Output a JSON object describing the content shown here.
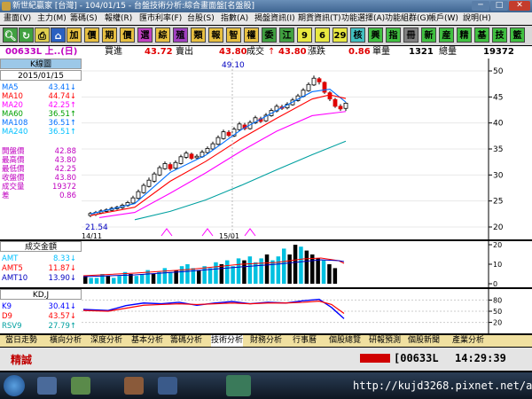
{
  "window": {
    "title": "新世紀贏家 [台灣] - 104/01/15 - 台盤技術分析:綜合畫面盤[名盤股]",
    "min": "─",
    "max": "□",
    "close": "✕"
  },
  "menu": [
    "畫面(V)",
    "主力(M)",
    "籌碼(S)",
    "報權(R)",
    "匯市利率(F)",
    "台股(S)",
    "指數(A)",
    "揭盤資訊(I)",
    "期貨資訊(T)",
    "功能選擇(A)",
    "功能組群(G)",
    "帳戶(W)",
    "說明(H)"
  ],
  "toolbar": {
    "buttons": [
      "加",
      "價",
      "期",
      "價",
      "選",
      "綜",
      "殖",
      "類",
      "報",
      "智",
      "權",
      "委",
      "江",
      "9",
      "6",
      "29",
      "核",
      "興",
      "指",
      "冊",
      "新",
      "産",
      "精",
      "基",
      "技",
      "籃"
    ]
  },
  "quote": {
    "symbol": "00633L 上..(日)",
    "buy_label": "買進",
    "buy": "43.72",
    "sell_label": "賣出",
    "sell": "43.80",
    "trade_label": "成交",
    "trade_arrow": "↑",
    "trade": "43.80",
    "change_label": "漲跌",
    "change": "0.86",
    "vol_label": "單量",
    "vol": "1321",
    "total_label": "總量",
    "total": "19372"
  },
  "kpanel": {
    "title": "K線圖",
    "date": "2015/01/15",
    "ma": [
      {
        "label": "MA5",
        "value": "43.41",
        "arrow": "↓",
        "color": "#0070ff"
      },
      {
        "label": "MA10",
        "value": "44.74",
        "arrow": "↓",
        "color": "#ff0000"
      },
      {
        "label": "MA20",
        "value": "42.25",
        "arrow": "↑",
        "color": "#ff00ff"
      },
      {
        "label": "MA60",
        "value": "36.51",
        "arrow": "↑",
        "color": "#00a000"
      },
      {
        "label": "MA108",
        "value": "36.51",
        "arrow": "↑",
        "color": "#0070ff"
      },
      {
        "label": "MA240",
        "value": "36.51",
        "arrow": "↑",
        "color": "#00c0ff"
      }
    ],
    "ohlc": [
      {
        "label": "開盤價",
        "value": "42.88"
      },
      {
        "label": "最高價",
        "value": "43.80"
      },
      {
        "label": "最低價",
        "value": "42.25"
      },
      {
        "label": "收盤價",
        "value": "43.80"
      },
      {
        "label": "成交量",
        "value": "19372"
      },
      {
        "label": "差",
        "value": "0.86"
      }
    ]
  },
  "kchart": {
    "high_label": "49.10",
    "low_label": "21.54",
    "x_labels": [
      "14/11",
      "15/01"
    ],
    "y_ticks": [
      "50",
      "45",
      "40",
      "35",
      "30",
      "25",
      "20"
    ]
  },
  "volpanel": {
    "title": "成交金額",
    "rows": [
      {
        "label": "AMT",
        "value": "8.33",
        "arrow": "↓",
        "color": "#00c0ff"
      },
      {
        "label": "AMT5",
        "value": "11.87",
        "arrow": "↓",
        "color": "#ff0000"
      },
      {
        "label": "AMT10",
        "value": "13.90",
        "arrow": "↓",
        "color": "#0000c0"
      }
    ],
    "y_ticks": [
      "20",
      "10",
      "0"
    ]
  },
  "kdpanel": {
    "title": "KD,J",
    "rows": [
      {
        "label": "K9",
        "value": "30.41",
        "arrow": "↓",
        "color": "#0000ff"
      },
      {
        "label": "D9",
        "value": "43.57",
        "arrow": "↓",
        "color": "#ff0000"
      },
      {
        "label": "RSV9",
        "value": "27.79",
        "arrow": "↑",
        "color": "#00a0a0"
      }
    ],
    "y_ticks": [
      "80",
      "50",
      "20"
    ]
  },
  "tabs": [
    "當日走勢",
    "橫向分析",
    "深度分析",
    "基本分析",
    "籌碼分析",
    "技術分析",
    "財務分析",
    "行事曆",
    "個股總覽",
    "研報預測",
    "個股新聞",
    "產業分析"
  ],
  "status": {
    "brand": "精誠",
    "code": "[00633L",
    "time": "14:29:39"
  },
  "taskbar": {
    "url": "http://kujd3268.pixnet.net/album"
  }
}
